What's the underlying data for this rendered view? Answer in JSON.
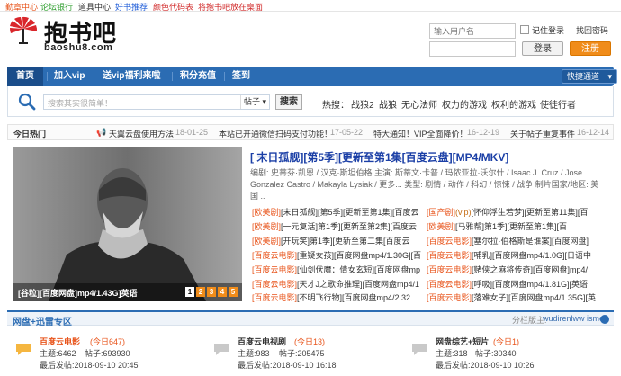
{
  "topbar": {
    "links": [
      {
        "label": "勤章中心",
        "color": "#e8541b"
      },
      {
        "label": "论坛银行",
        "color": "#2f9e2f"
      },
      {
        "label": "道具中心",
        "color": "#333333"
      },
      {
        "label": "好书推荐",
        "color": "#1f5dd8"
      },
      {
        "label": "颜色代码表",
        "color": "#d12a2a"
      },
      {
        "label": "将抱书吧放在桌面",
        "color": "#d12a2a"
      }
    ]
  },
  "logo": {
    "name": "抱书吧",
    "domain": "baoshu8.com"
  },
  "login": {
    "username_placeholder": "输入用户名",
    "remember": "记住登录",
    "find_password": "找回密码",
    "login_button": "登录",
    "register_button": "注册"
  },
  "nav": {
    "items": [
      "首页",
      "加入vip",
      "送vip福利来啦",
      "积分充值",
      "签到"
    ],
    "quick_label": "快捷通道"
  },
  "search": {
    "placeholder": "搜索其实很简单！",
    "scope": "帖子",
    "button": "搜索",
    "hot_label": "热搜：",
    "hot_terms": [
      "战狼2",
      "战狼",
      "无心法师",
      "权力的游戏",
      "权利的游戏",
      "使徒行者"
    ]
  },
  "today_hot": {
    "label": "今日热门",
    "items": [
      {
        "title": "天翼云盘使用方法",
        "date": "18-01-25"
      },
      {
        "title": "本站已开通微信扫码支付功能！",
        "date": "17-05-22"
      },
      {
        "title": "特大通知！VIP全面降价！",
        "date": "16-12-19"
      },
      {
        "title": "关于帖子重复事件",
        "date": "16-12-14"
      }
    ]
  },
  "featured": {
    "title": "[ 末日孤舰][第5季][更新至第1集[百度云盘][MP4/MKV]",
    "description": "编剧: 史蒂芬·凯恩 / 汉克·斯坦伯格 主演: 斯蒂文·卡普 / 玛侬亚拉·沃尔什 / Isaac J. Cruz / Jose Gonzalez Castro / Makayla Lysiak / 更多... 类型: 剧情 / 动作 / 科幻 / 惊悚 / 战争 制片国家/地区: 美国 ..",
    "image_caption": "[谷粒][百度网盘]mp4/1.43G]英语",
    "pages": [
      "1",
      "2",
      "3",
      "4",
      "5"
    ],
    "active_page": "1"
  },
  "thread_grid": [
    [
      {
        "tag": "[欧美剧]",
        "text": "[末日孤舰][第5季][更新至第1集][百度云"
      },
      {
        "tag": "[国产剧]",
        "vip": "(vip)",
        "text": "[怀仰浮生若梦][更新至第11集][百"
      }
    ],
    [
      {
        "tag": "[欧美剧]",
        "text": "[一元复活]第1季][更新至第2集][百度云"
      },
      {
        "tag": "[欧美剧]",
        "text": "[马雅帮]第1季][更新至第1集][百"
      }
    ],
    [
      {
        "tag": "[欧美剧]",
        "text": "[开玩笑]第1季][更新至第二集[百度云"
      },
      {
        "tag": "[百度云电影]",
        "text": "[塞尔拉·伯格斯是谁案][百度网盘]"
      }
    ],
    [
      {
        "tag": "[百度云电影]",
        "text": "[重疑女孩][百度网盘mp4/1.30G][百"
      },
      {
        "tag": "[百度云电影]",
        "text": "[哺乳][百度网盘mp4/1.0G][日语中"
      }
    ],
    [
      {
        "tag": "[百度云电影]",
        "text": "[仙剑伏魔：倩女玄短][百度网盘mp"
      },
      {
        "tag": "[百度云电影]",
        "text": "[赌侠之麻将传奇][百度网盘]mp4/"
      }
    ],
    [
      {
        "tag": "[百度云电影]",
        "text": "[天才J之歌命推理][百度网盘mp4/1"
      },
      {
        "tag": "[百度云电影]",
        "text": "[呼吸][百度网盘mp4/1.81G][英语"
      }
    ],
    [
      {
        "tag": "[百度云电影]",
        "text": "[不明飞行物][百度网盘mp4/2.32"
      },
      {
        "tag": "[百度云电影]",
        "text": "[落难女子][百度网盘mp4/1.35G][英"
      }
    ]
  ],
  "forum": {
    "section_title": "网盘+迅雷专区",
    "moderator_label": "分栏版主:",
    "moderators": "wudirenlww isme",
    "boards": [
      {
        "name": "百度云电影",
        "today": "(今日647)",
        "themes": "主题:6462",
        "posts": "帖子:693930",
        "last": "最后发帖:2018-09-10 20:45",
        "color": "#e8541b"
      },
      {
        "name": "百度云电视剧",
        "today": "(今日13)",
        "themes": "主题:983",
        "posts": "帖子:205475",
        "last": "最后发帖:2018-09-10 16:18",
        "color": "#333333"
      },
      {
        "name": "网盘综艺+短片",
        "today": "(今日1)",
        "themes": "主题:318",
        "posts": "帖子:30340",
        "last": "最后发帖:2018-09-10 10:26",
        "color": "#333333"
      }
    ]
  }
}
